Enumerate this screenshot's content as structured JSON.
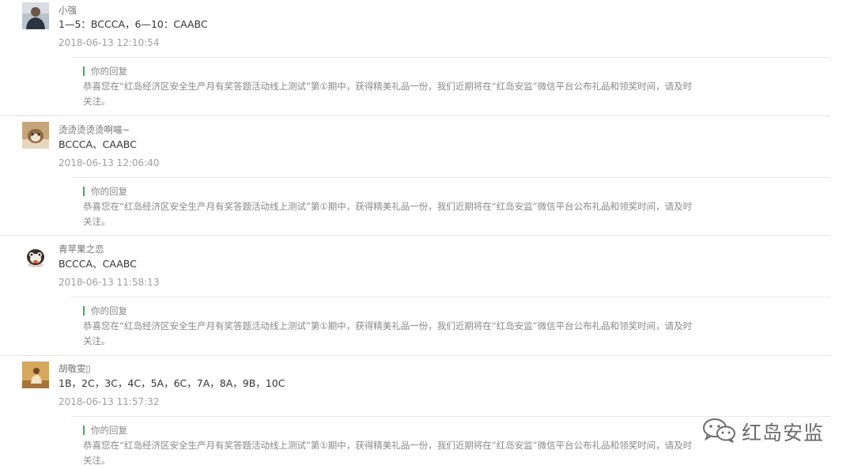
{
  "comments": [
    {
      "nickname": "小强",
      "content": "1—5：BCCCA，6—10：CAABC",
      "time": "2018-06-13 12:10:54",
      "reply_label": "你的回复",
      "reply_text": "恭喜您在“红岛经济区安全生产月有奖答题活动线上测试”第①期中，获得精美礼品一份，我们近期将在“红岛安监”微信平台公布礼品和领奖时间，请及时关注。"
    },
    {
      "nickname": "烫烫烫烫烫啊喵~",
      "content": "BCCCA、CAABC",
      "time": "2018-06-13 12:06:40",
      "reply_label": "你的回复",
      "reply_text": "恭喜您在“红岛经济区安全生产月有奖答题活动线上测试”第①期中，获得精美礼品一份，我们近期将在“红岛安监”微信平台公布礼品和领奖时间，请及时关注。"
    },
    {
      "nickname": "青苹果之恋",
      "content": "BCCCA、CAABC",
      "time": "2018-06-13 11:58:13",
      "reply_label": "你的回复",
      "reply_text": "恭喜您在“红岛经济区安全生产月有奖答题活动线上测试”第①期中，获得精美礼品一份，我们近期将在“红岛安监”微信平台公布礼品和领奖时间，请及时关注。"
    },
    {
      "nickname": "胡敬雯▯",
      "content": "1B，2C，3C，4C，5A，6C，7A，8A，9B，10C",
      "time": "2018-06-13 11:57:32",
      "reply_label": "你的回复",
      "reply_text": "恭喜您在“红岛经济区安全生产月有奖答题活动线上测试”第①期中，获得精美礼品一份，我们近期将在“红岛安监”微信平台公布礼品和领奖时间，请及时关注。"
    }
  ],
  "watermark": {
    "icon": "wechat-icon",
    "text": "红岛安监"
  },
  "colors": {
    "reply_accent": "#3db04f",
    "nickname": "#727272",
    "time": "#a0a0a0",
    "reply_text": "#888888"
  }
}
